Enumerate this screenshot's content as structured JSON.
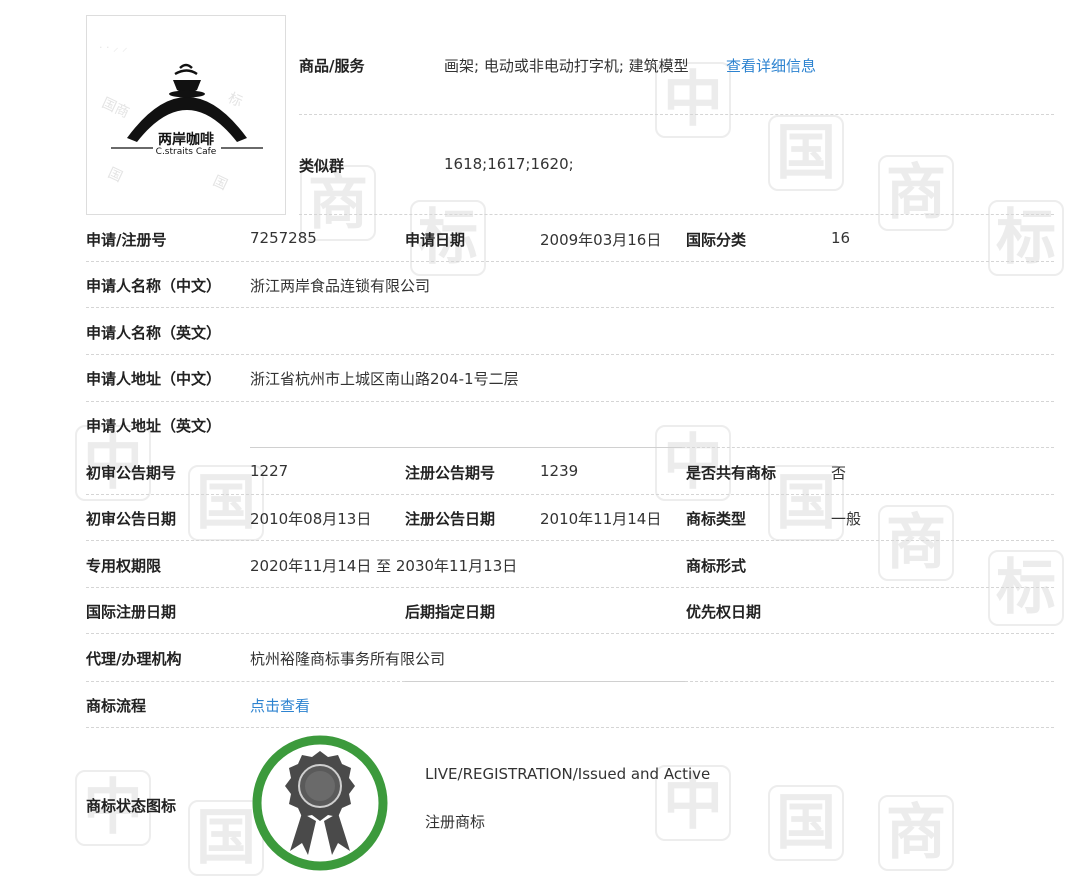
{
  "watermark": {
    "chars": [
      "中",
      "国",
      "商",
      "标"
    ]
  },
  "logo": {
    "name_cn": "两岸咖啡",
    "name_en": "C.straits Cafe",
    "stamp_text": "国商标"
  },
  "goods": {
    "label": "商品/服务",
    "value": "画架; 电动或非电动打字机; 建筑模型",
    "detail_link": "查看详细信息"
  },
  "similar_group": {
    "label": "类似群",
    "value": "1618;1617;1620;"
  },
  "rows": {
    "reg_no_label": "申请/注册号",
    "reg_no": "7257285",
    "apply_date_label": "申请日期",
    "apply_date": "2009年03月16日",
    "intl_class_label": "国际分类",
    "intl_class": "16",
    "applicant_cn_label": "申请人名称（中文）",
    "applicant_cn": "浙江两岸食品连锁有限公司",
    "applicant_en_label": "申请人名称（英文）",
    "applicant_en": "",
    "address_cn_label": "申请人地址（中文）",
    "address_cn": "浙江省杭州市上城区南山路204-1号二层",
    "address_en_label": "申请人地址（英文）",
    "address_en": "",
    "prelim_issue_label": "初审公告期号",
    "prelim_issue": "1227",
    "reg_issue_label": "注册公告期号",
    "reg_issue": "1239",
    "shared_label": "是否共有商标",
    "shared": "否",
    "prelim_date_label": "初审公告日期",
    "prelim_date": "2010年08月13日",
    "reg_date_label": "注册公告日期",
    "reg_date": "2010年11月14日",
    "tm_type_label": "商标类型",
    "tm_type": "一般",
    "exclusive_label": "专用权期限",
    "exclusive": "2020年11月14日 至 2030年11月13日",
    "tm_form_label": "商标形式",
    "tm_form": "",
    "intl_reg_date_label": "国际注册日期",
    "intl_reg_date": "",
    "later_date_label": "后期指定日期",
    "later_date": "",
    "priority_date_label": "优先权日期",
    "priority_date": "",
    "agency_label": "代理/办理机构",
    "agency": "杭州裕隆商标事务所有限公司",
    "process_label": "商标流程",
    "process_link": "点击查看",
    "status_icon_label": "商标状态图标",
    "status_en": "LIVE/REGISTRATION/Issued and Active",
    "status_cn": "注册商标"
  },
  "colors": {
    "link": "#2d83d0",
    "badge_ring": "#3c9a3c",
    "badge_dark": "#4a4a4a"
  }
}
